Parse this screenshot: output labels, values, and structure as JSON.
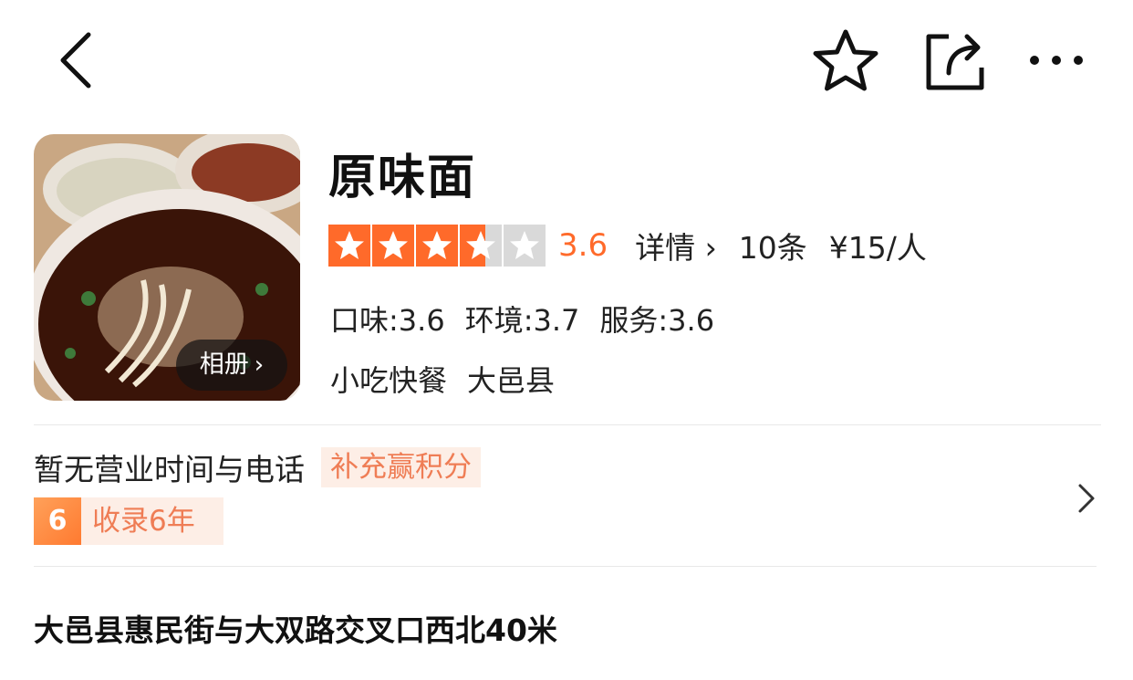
{
  "icons": {
    "back": "chevron-left-icon",
    "favorite": "star-outline-icon",
    "share": "share-icon",
    "more": "more-dots-icon",
    "chevron_right": "chevron-right-icon"
  },
  "colors": {
    "accent": "#ff6a2a",
    "star_empty": "#d9d9d9",
    "tag_bg": "#fdeee6",
    "tag_text": "#ef7d55"
  },
  "shop": {
    "name": "原味面",
    "album_label": "相册",
    "rating": {
      "stars_value": 3.6,
      "stars_max": 5,
      "score": "3.6",
      "detail_label": "详情",
      "review_count": "10条",
      "price": "¥15/人"
    },
    "sub_scores": [
      "口味:3.6",
      "环境:3.7",
      "服务:3.6"
    ],
    "categories": [
      "小吃快餐",
      "大邑县"
    ]
  },
  "info": {
    "hours_text": "暂无营业时间与电话",
    "supplement_label": "补充赢积分",
    "years_badge": "6",
    "years_text": "收录6年"
  },
  "address": "大邑县惠民街与大双路交叉口西北40米"
}
